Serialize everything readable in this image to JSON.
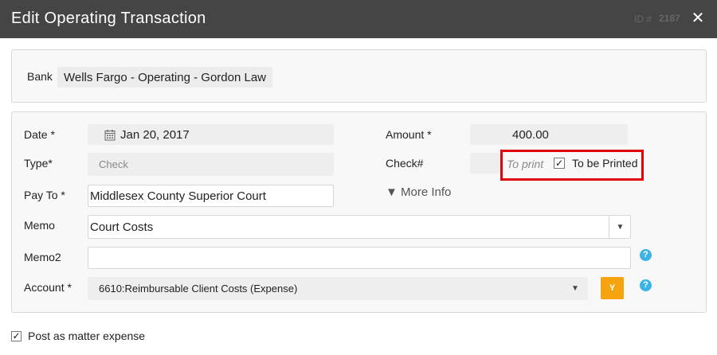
{
  "dialog": {
    "title": "Edit Operating Transaction",
    "id_label": "ID #",
    "id_value": "2187",
    "close_glyph": "✕"
  },
  "bank": {
    "label": "Bank",
    "value": "Wells Fargo - Operating - Gordon Law"
  },
  "form": {
    "date": {
      "label": "Date *",
      "value": "Jan 20, 2017",
      "icon": "calendar-icon"
    },
    "type": {
      "label": "Type*",
      "placeholder": "Check"
    },
    "pay_to": {
      "label": "Pay To *",
      "value": "Middlesex County Superior Court"
    },
    "amount": {
      "label": "Amount *",
      "value": "400.00"
    },
    "check_no": {
      "label": "Check#",
      "to_print_text": "To print",
      "to_be_printed_label": "To be Printed",
      "to_be_printed_checked": true
    },
    "more_info": {
      "label": "▼ More Info"
    },
    "memo": {
      "label": "Memo",
      "value": "Court Costs"
    },
    "memo2": {
      "label": "Memo2",
      "value": ""
    },
    "account": {
      "label": "Account *",
      "value": "6610:Reimbursable Client Costs (Expense)",
      "y_button": "Y"
    }
  },
  "footer": {
    "post_as_matter_expense_label": "Post as matter expense",
    "post_as_matter_expense_checked": true
  },
  "colors": {
    "titlebar": "#454545",
    "highlight": "#e0000b",
    "help": "#3bb4e5",
    "y_button": "#f5a30f"
  }
}
